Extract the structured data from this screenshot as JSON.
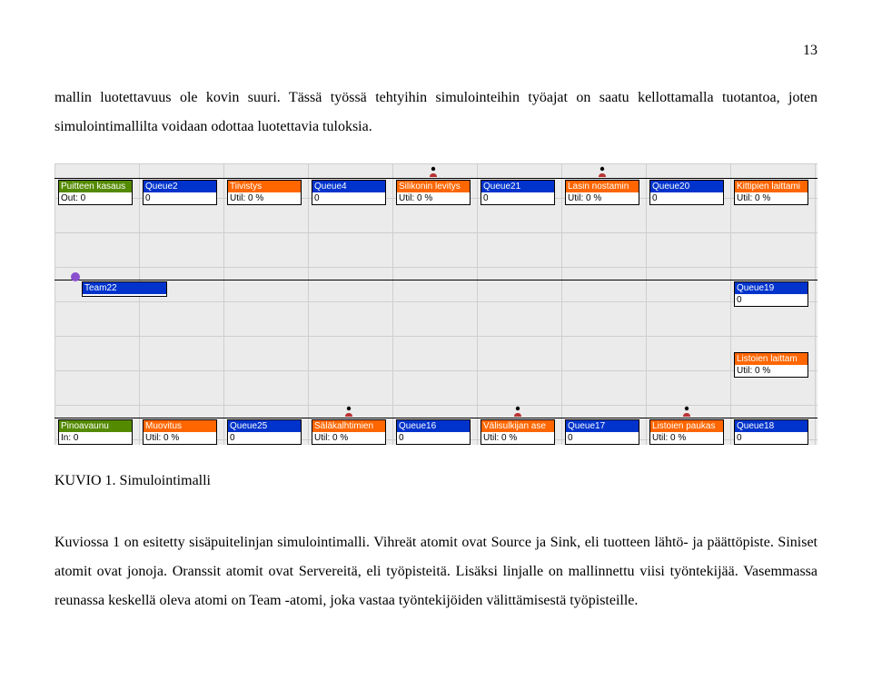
{
  "pageNumber": "13",
  "para1": "mallin luotettavuus ole kovin suuri. Tässä työssä tehtyihin simulointeihin työajat on saatu kellottamalla tuotantoa, joten simulointimallilta voidaan odottaa luotettavia tuloksia.",
  "caption": "KUVIO 1. Simulointimalli",
  "para2": "Kuviossa 1 on esitetty sisäpuitelinjan simulointimalli. Vihreät atomit ovat Source ja Sink, eli tuotteen lähtö- ja päättöpiste. Siniset atomit ovat jonoja. Oranssit atomit ovat Servereitä, eli työpisteitä. Lisäksi linjalle on mallinnettu viisi työntekijää. Vasemmassa reunassa keskellä oleva atomi on Team -atomi, joka vastaa työntekijöiden välittämisestä työpisteille.",
  "atoms": {
    "r1": {
      "a": {
        "label": "Puitteen kasaus",
        "stat": "Out: 0"
      },
      "b": {
        "label": "Queue2",
        "stat": "0"
      },
      "c": {
        "label": "Tiivistys",
        "stat": "Util: 0 %"
      },
      "d": {
        "label": "Queue4",
        "stat": "0"
      },
      "e": {
        "label": "Silikonin levitys",
        "stat": "Util: 0 %"
      },
      "f": {
        "label": "Queue21",
        "stat": "0"
      },
      "g": {
        "label": "Lasin nostamin",
        "stat": "Util: 0 %"
      },
      "h": {
        "label": "Queue20",
        "stat": "0"
      },
      "i": {
        "label": "Kittipien laittami",
        "stat": "Util: 0 %"
      }
    },
    "team": {
      "label": "Team22",
      "stat": ""
    },
    "q19": {
      "label": "Queue19",
      "stat": "0"
    },
    "listlait": {
      "label": "Listoien laittam",
      "stat": "Util: 0 %"
    },
    "r3": {
      "a": {
        "label": "Pinoavaunu",
        "stat": "In: 0"
      },
      "b": {
        "label": "Muovitus",
        "stat": "Util: 0 %"
      },
      "c": {
        "label": "Queue25",
        "stat": "0"
      },
      "d": {
        "label": "Säläkalhtimien",
        "stat": "Util: 0 %"
      },
      "e": {
        "label": "Queue16",
        "stat": "0"
      },
      "f": {
        "label": "Välisulkijan ase",
        "stat": "Util: 0 %"
      },
      "g": {
        "label": "Queue17",
        "stat": "0"
      },
      "h": {
        "label": "Listoien paukas",
        "stat": "Util: 0 %"
      },
      "i": {
        "label": "Queue18",
        "stat": "0"
      }
    }
  }
}
